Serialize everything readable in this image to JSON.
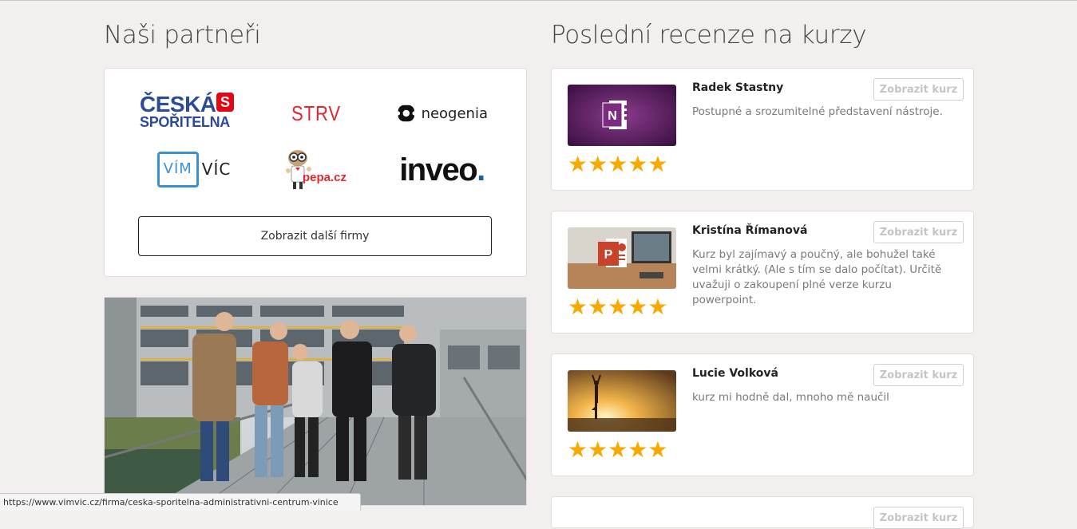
{
  "partners": {
    "title": "Naši partneři",
    "logos": {
      "cs_line1": "ČESKÁ",
      "cs_line2": "SPOŘITELNA",
      "strv": "STRV",
      "neogenia": "neogenia",
      "vim": "VÍM",
      "vic": "VÍC",
      "pepa": "pepa.cz",
      "inveo": "inveo",
      "inveo_dot": "."
    },
    "more_button": "Zobrazit další firmy"
  },
  "reviews": {
    "title": "Poslední recenze na kurzy",
    "button_label": "Zobrazit kurz",
    "items": [
      {
        "name": "Radek Stastny",
        "text": "Postupné a srozumitelné představení nástroje.",
        "stars": "★★★★★",
        "rating": 5,
        "thumb_icon": "onenote-icon"
      },
      {
        "name": "Kristína Římanová",
        "text": "Kurz byl zajímavý a poučný, ale bohužel také velmi krátký. (Ale s tím se dalo počítat). Určitě uvažuji o zakoupení plné verze kurzu powerpoint.",
        "stars": "★★★★★",
        "rating": 5,
        "thumb_icon": "powerpoint-icon"
      },
      {
        "name": "Lucie Volková",
        "text": "kurz mi hodně dal, mnoho mě naučil",
        "stars": "★★★★★",
        "rating": 5,
        "thumb_icon": "yoga-sunset-image"
      }
    ]
  },
  "status_bar": {
    "url": "https://www.vimvic.cz/firma/ceska-sporitelna-administrativni-centrum-vinice"
  },
  "colors": {
    "page_bg": "#f2efee",
    "star": "#f7a900",
    "cs_blue": "#2b4a9a",
    "strv_red": "#e3262d"
  }
}
